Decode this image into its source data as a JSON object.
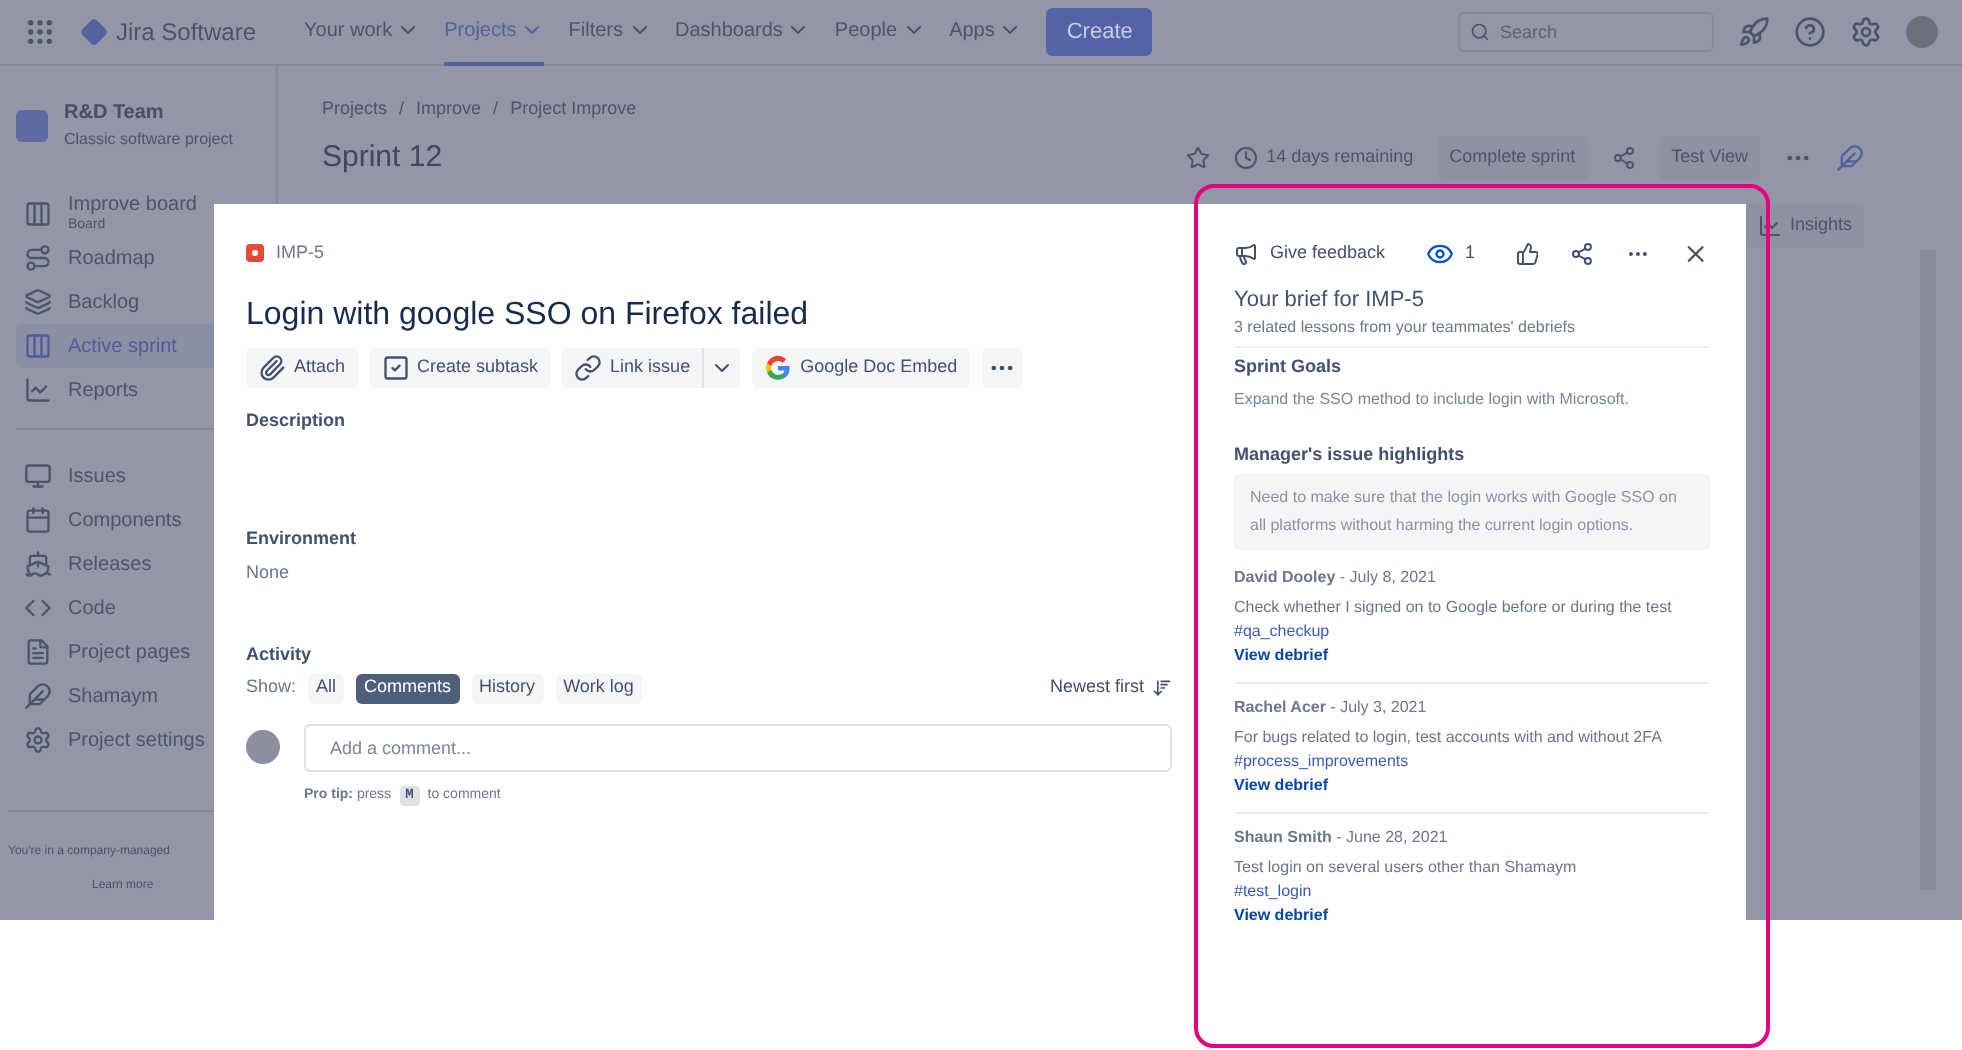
{
  "nav": {
    "brand": "Jira Software",
    "items": [
      {
        "label": "Your work",
        "selected": false
      },
      {
        "label": "Projects",
        "selected": true
      },
      {
        "label": "Filters",
        "selected": false
      },
      {
        "label": "Dashboards",
        "selected": false
      },
      {
        "label": "People",
        "selected": false
      },
      {
        "label": "Apps",
        "selected": false
      }
    ],
    "create": "Create",
    "search_placeholder": "Search"
  },
  "sidebar": {
    "project_name": "R&D Team",
    "project_type": "Classic software project",
    "groups": [
      [
        {
          "label": "Improve board",
          "sublabel": "Board",
          "selected": false
        },
        {
          "label": "Roadmap",
          "selected": false
        },
        {
          "label": "Backlog",
          "selected": false
        },
        {
          "label": "Active sprint",
          "selected": true
        },
        {
          "label": "Reports",
          "selected": false
        }
      ],
      [
        {
          "label": "Issues",
          "selected": false
        },
        {
          "label": "Components",
          "selected": false
        },
        {
          "label": "Releases",
          "selected": false
        },
        {
          "label": "Code",
          "selected": false
        },
        {
          "label": "Project pages",
          "selected": false
        },
        {
          "label": "Shamaym",
          "selected": false
        },
        {
          "label": "Project settings",
          "selected": false
        }
      ]
    ],
    "footer_text": "You're in a company-managed",
    "footer_link": "Learn more"
  },
  "header": {
    "breadcrumbs": [
      "Projects",
      "Improve",
      "Project Improve"
    ],
    "separator": "/",
    "title": "Sprint 12",
    "remaining": "14 days remaining",
    "complete": "Complete sprint",
    "view": "Test View",
    "insights": "Insights"
  },
  "issue": {
    "key": "IMP-5",
    "title": "Login with google SSO on Firefox failed",
    "actions": [
      {
        "kind": "attach",
        "label": "Attach"
      },
      {
        "kind": "subtask",
        "label": "Create subtask"
      },
      {
        "kind": "link",
        "label": "Link issue"
      },
      {
        "kind": "google",
        "label": "Google Doc Embed"
      }
    ],
    "description_label": "Description",
    "environment_label": "Environment",
    "environment_value": "None",
    "activity_label": "Activity",
    "show_label": "Show:",
    "filters": [
      {
        "label": "All",
        "selected": false
      },
      {
        "label": "Comments",
        "selected": true
      },
      {
        "label": "History",
        "selected": false
      },
      {
        "label": "Work log",
        "selected": false
      }
    ],
    "sort_label": "Newest first",
    "comment_placeholder": "Add a comment...",
    "pro_tip_before": "**Pro tip:** press",
    "pro_tip_key": "M",
    "pro_tip_after": "to comment"
  },
  "brief": {
    "feedback": "Give feedback",
    "watchers": "1",
    "title": "Your brief for IMP-5",
    "subtitle": "3 related lessons from your teammates' debriefs",
    "sprint_goals_label": "Sprint Goals",
    "sprint_goal": "Expand the SSO method to include login with Microsoft.",
    "highlights_label": "Manager's issue highlights",
    "highlight": "Need to make sure that the login works with Google SSO on all platforms without harming the current login options.",
    "lessons": [
      {
        "byline": "**David Dooley** - July 8, 2021",
        "text": "Check whether I signed on to Google before or during the test",
        "tag": "#qa_checkup",
        "link": "View debrief"
      },
      {
        "byline": "**Rachel Acer** - July 3, 2021",
        "text": "For bugs related to login, test accounts with and without 2FA",
        "tag": "#process_improvements",
        "link": "View debrief"
      },
      {
        "byline": "**Shaun Smith** - June 28, 2021",
        "text": "Test login on several users other than Shamaym",
        "tag": "#test_login",
        "link": "View debrief"
      }
    ]
  }
}
